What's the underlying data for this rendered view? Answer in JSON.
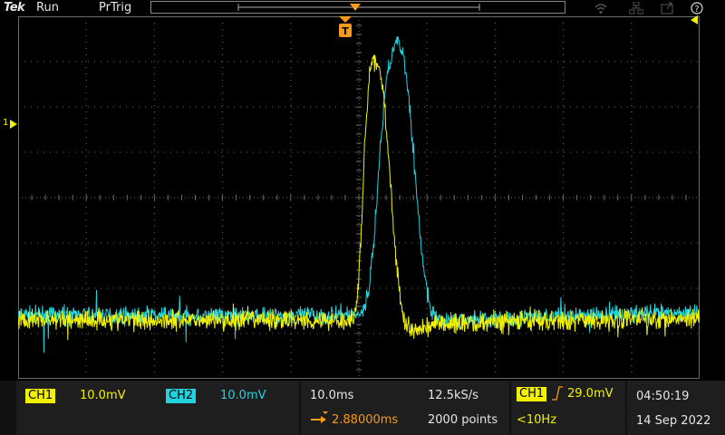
{
  "topbar": {
    "logo": "Tek",
    "acq_state": "Run",
    "trigger_state": "PrTrig",
    "help_label": "?"
  },
  "trigger_marker": "T",
  "ch1_marker": "1",
  "colors": {
    "ch1": "#f2f200",
    "ch2": "#22d3dd",
    "trigger": "#f59a1b",
    "grid": "#6a6a6a",
    "background": "#000000"
  },
  "bottom": {
    "ch1": {
      "label": "CH1",
      "scale": "10.0mV"
    },
    "ch2": {
      "label": "CH2",
      "scale": "10.0mV"
    },
    "horizontal": {
      "time_per_div": "10.0ms",
      "sample_rate": "12.5kS/s",
      "position": "2.88000ms",
      "record_length": "2000 points"
    },
    "trigger": {
      "source": "CH1",
      "level": "29.0mV",
      "frequency": "<10Hz"
    },
    "clock": {
      "time": "04:50:19",
      "date": "14 Sep 2022"
    }
  },
  "chart_data": {
    "type": "line",
    "xlabel": "",
    "ylabel": "",
    "x_unit": "ms",
    "y_unit": "mV",
    "x_per_div": 10,
    "y_per_div": 10,
    "x_range": [
      -50,
      50
    ],
    "y_range": [
      -40,
      40
    ],
    "grid": true,
    "series": [
      {
        "channel": "CH1",
        "color": "#f2f200",
        "baseline_mV": -27,
        "noise_mV": 1.4,
        "points": [
          [
            -50,
            -27
          ],
          [
            -0.8,
            -27
          ],
          [
            -0.2,
            -22
          ],
          [
            0.3,
            -10
          ],
          [
            0.8,
            10
          ],
          [
            1.5,
            27
          ],
          [
            2.2,
            30
          ],
          [
            2.8,
            29.5
          ],
          [
            3.5,
            25
          ],
          [
            4.2,
            12
          ],
          [
            5,
            -5
          ],
          [
            6,
            -22
          ],
          [
            7,
            -29
          ],
          [
            8,
            -29.5
          ],
          [
            11,
            -28
          ],
          [
            20,
            -27.5
          ],
          [
            50,
            -26.5
          ]
        ]
      },
      {
        "channel": "CH2",
        "color": "#22d3dd",
        "baseline_mV": -26,
        "noise_mV": 1.2,
        "points": [
          [
            -50,
            -26
          ],
          [
            -0.2,
            -26
          ],
          [
            0.5,
            -25
          ],
          [
            1.3,
            -22
          ],
          [
            2.2,
            -10
          ],
          [
            3,
            8
          ],
          [
            4,
            26
          ],
          [
            5,
            33
          ],
          [
            5.8,
            34.5
          ],
          [
            6.6,
            31
          ],
          [
            7.5,
            20
          ],
          [
            8.5,
            0
          ],
          [
            9.5,
            -16
          ],
          [
            10.5,
            -25
          ],
          [
            11.5,
            -27
          ],
          [
            14,
            -27
          ],
          [
            30,
            -26
          ],
          [
            50,
            -25.5
          ]
        ]
      }
    ]
  }
}
